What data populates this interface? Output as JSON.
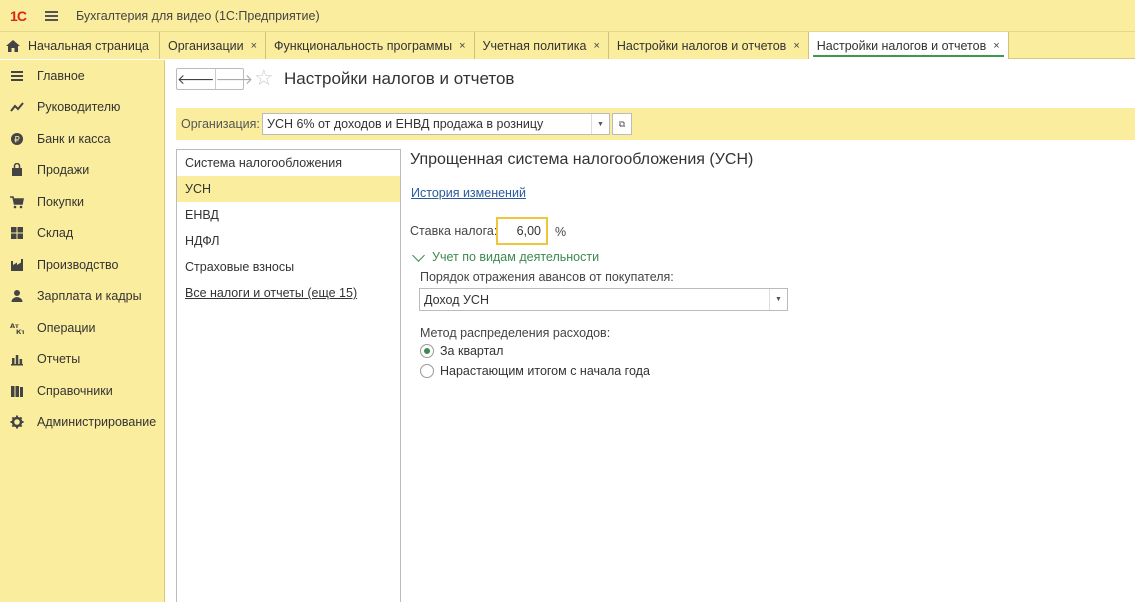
{
  "window": {
    "logo_text": "1С",
    "title": "Бухгалтерия для видео  (1С:Предприятие)"
  },
  "tabs": [
    {
      "label": "Начальная страница",
      "closable": false
    },
    {
      "label": "Организации",
      "closable": true
    },
    {
      "label": "Функциональность программы",
      "closable": true
    },
    {
      "label": "Учетная политика",
      "closable": true
    },
    {
      "label": "Настройки налогов и отчетов",
      "closable": true
    },
    {
      "label": "Настройки налогов и отчетов",
      "closable": true,
      "active": true
    }
  ],
  "close_glyph": "×",
  "sidebar": {
    "items": [
      {
        "label": "Главное",
        "icon": "menu-icon"
      },
      {
        "label": "Руководителю",
        "icon": "trend-icon"
      },
      {
        "label": "Банк и касса",
        "icon": "ruble-icon"
      },
      {
        "label": "Продажи",
        "icon": "bag-icon"
      },
      {
        "label": "Покупки",
        "icon": "cart-icon"
      },
      {
        "label": "Склад",
        "icon": "grid-icon"
      },
      {
        "label": "Производство",
        "icon": "factory-icon"
      },
      {
        "label": "Зарплата и кадры",
        "icon": "person-icon"
      },
      {
        "label": "Операции",
        "icon": "operations-icon"
      },
      {
        "label": "Отчеты",
        "icon": "chart-icon"
      },
      {
        "label": "Справочники",
        "icon": "books-icon"
      },
      {
        "label": "Администрирование",
        "icon": "gear-icon"
      }
    ]
  },
  "page": {
    "title": "Настройки налогов и отчетов",
    "back_glyph": "🡐",
    "forward_glyph": "🡒",
    "star_glyph": "☆"
  },
  "organization": {
    "label": "Организация:",
    "value": "УСН 6% от доходов и ЕНВД продажа в розницу"
  },
  "left_list": {
    "items": [
      {
        "label": "Система налогообложения",
        "selected": false,
        "link": false
      },
      {
        "label": "УСН",
        "selected": true,
        "link": false
      },
      {
        "label": "ЕНВД",
        "selected": false,
        "link": false
      },
      {
        "label": "НДФЛ",
        "selected": false,
        "link": false
      },
      {
        "label": "Страховые взносы",
        "selected": false,
        "link": false
      },
      {
        "label": "Все налоги и отчеты (еще 15)",
        "selected": false,
        "link": true
      }
    ]
  },
  "usn": {
    "title": "Упрощенная система налогообложения (УСН)",
    "history_link": "История изменений",
    "rate_label": "Ставка налога:",
    "rate_value": "6,00",
    "rate_unit": "%",
    "activity_toggle": "Учет по видам деятельности",
    "advances_label": "Порядок отражения авансов от покупателя:",
    "advances_value": "Доход УСН",
    "method_label": "Метод распределения расходов:",
    "method_options": [
      {
        "label": "За квартал",
        "checked": true
      },
      {
        "label": "Нарастающим итогом с начала года",
        "checked": false
      }
    ]
  },
  "colors": {
    "panel_yellow": "#fbed9e",
    "accent_green": "#3c9a4e",
    "input_focus": "#f0c53a"
  }
}
